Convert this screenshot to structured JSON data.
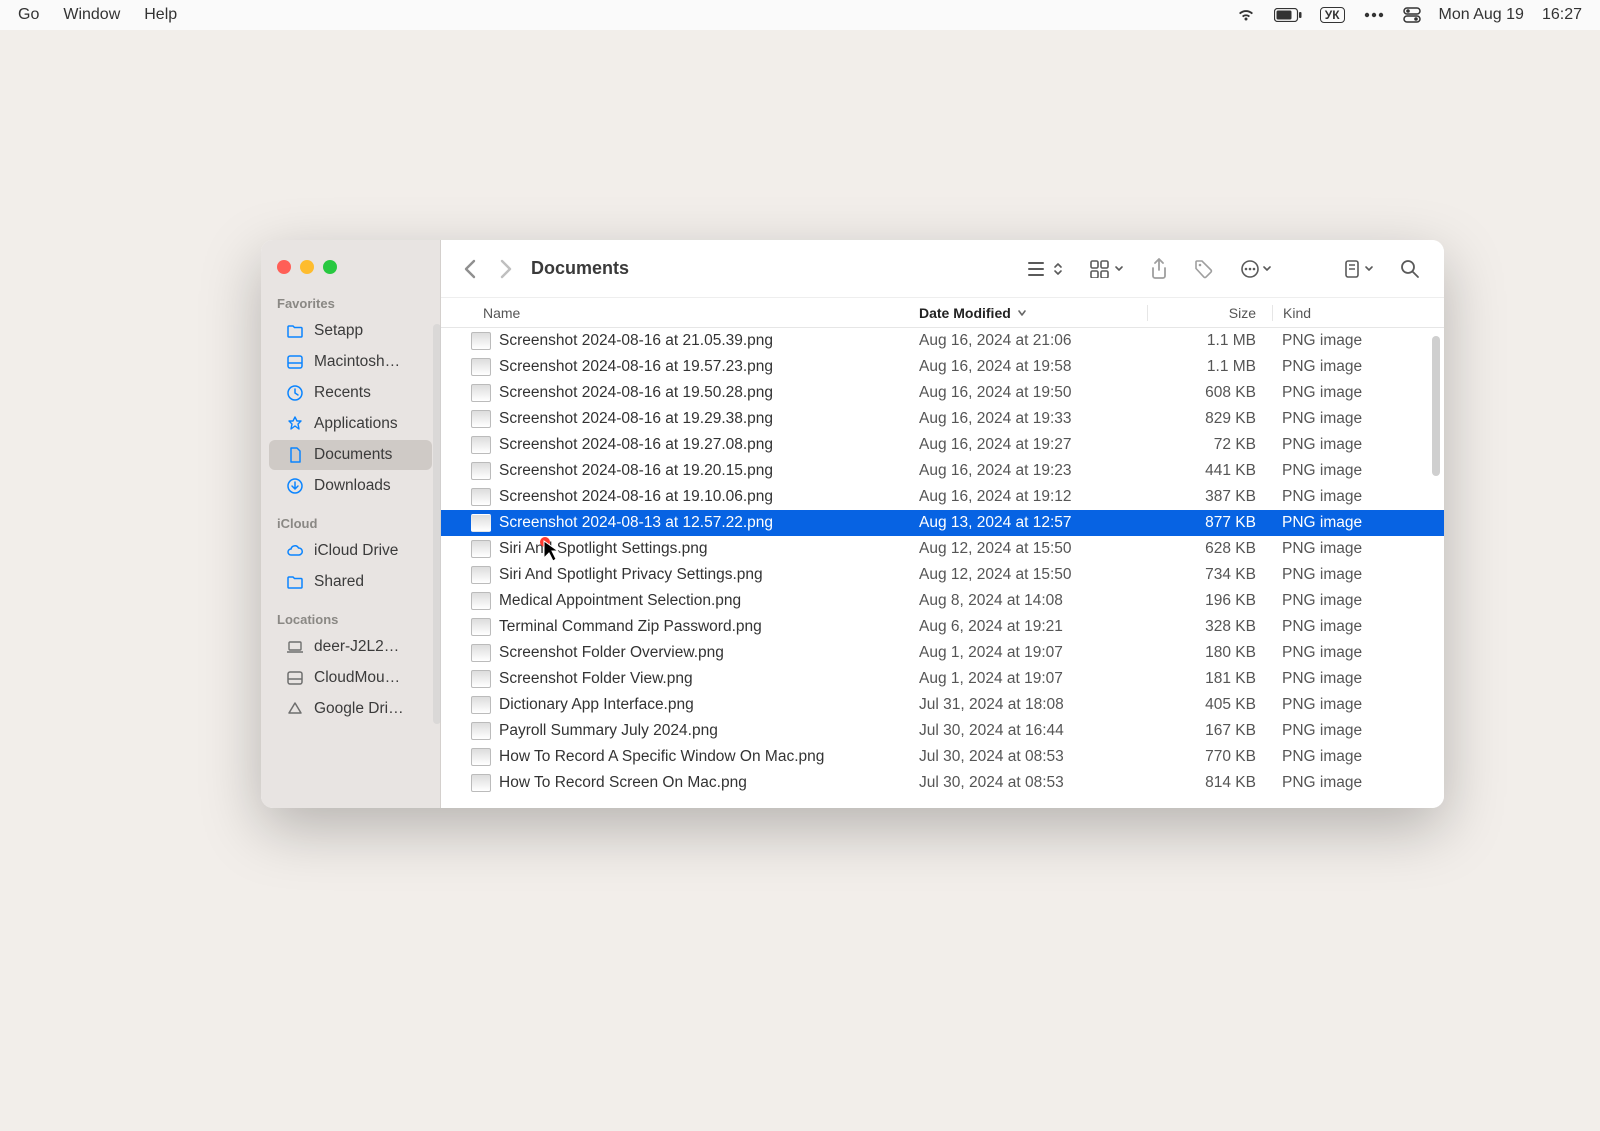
{
  "menubar": {
    "items": [
      "Go",
      "Window",
      "Help"
    ],
    "status": {
      "input_source": "УК",
      "date": "Mon Aug 19",
      "time": "16:27"
    }
  },
  "window": {
    "title": "Documents"
  },
  "sidebar": {
    "sections": [
      {
        "title": "Favorites",
        "items": [
          {
            "icon": "folder",
            "label": "Setapp"
          },
          {
            "icon": "disk",
            "label": "Macintosh…"
          },
          {
            "icon": "clock",
            "label": "Recents"
          },
          {
            "icon": "apps",
            "label": "Applications"
          },
          {
            "icon": "doc",
            "label": "Documents",
            "active": true
          },
          {
            "icon": "download",
            "label": "Downloads"
          }
        ]
      },
      {
        "title": "iCloud",
        "items": [
          {
            "icon": "cloud",
            "label": "iCloud Drive"
          },
          {
            "icon": "folder",
            "label": "Shared"
          }
        ]
      },
      {
        "title": "Locations",
        "items": [
          {
            "icon": "laptop",
            "label": "deer-J2L2…",
            "gray": true
          },
          {
            "icon": "disk",
            "label": "CloudMou…",
            "gray": true
          },
          {
            "icon": "mount",
            "label": "Google Dri…",
            "gray": true
          }
        ]
      }
    ]
  },
  "columns": {
    "name": "Name",
    "date": "Date Modified",
    "size": "Size",
    "kind": "Kind"
  },
  "files": [
    {
      "name": "Screenshot 2024-08-16 at 21.05.39.png",
      "date": "Aug 16, 2024 at 21:06",
      "size": "1.1 MB",
      "kind": "PNG image"
    },
    {
      "name": "Screenshot 2024-08-16 at 19.57.23.png",
      "date": "Aug 16, 2024 at 19:58",
      "size": "1.1 MB",
      "kind": "PNG image"
    },
    {
      "name": "Screenshot 2024-08-16 at 19.50.28.png",
      "date": "Aug 16, 2024 at 19:50",
      "size": "608 KB",
      "kind": "PNG image"
    },
    {
      "name": "Screenshot 2024-08-16 at 19.29.38.png",
      "date": "Aug 16, 2024 at 19:33",
      "size": "829 KB",
      "kind": "PNG image"
    },
    {
      "name": "Screenshot 2024-08-16 at 19.27.08.png",
      "date": "Aug 16, 2024 at 19:27",
      "size": "72 KB",
      "kind": "PNG image"
    },
    {
      "name": "Screenshot 2024-08-16 at 19.20.15.png",
      "date": "Aug 16, 2024 at 19:23",
      "size": "441 KB",
      "kind": "PNG image"
    },
    {
      "name": "Screenshot 2024-08-16 at 19.10.06.png",
      "date": "Aug 16, 2024 at 19:12",
      "size": "387 KB",
      "kind": "PNG image"
    },
    {
      "name": "Screenshot 2024-08-13 at 12.57.22.png",
      "date": "Aug 13, 2024 at 12:57",
      "size": "877 KB",
      "kind": "PNG image",
      "selected": true
    },
    {
      "name": "Siri And Spotlight Settings.png",
      "date": "Aug 12, 2024 at 15:50",
      "size": "628 KB",
      "kind": "PNG image"
    },
    {
      "name": "Siri And Spotlight Privacy Settings.png",
      "date": "Aug 12, 2024 at 15:50",
      "size": "734 KB",
      "kind": "PNG image"
    },
    {
      "name": "Medical Appointment Selection.png",
      "date": "Aug 8, 2024 at 14:08",
      "size": "196 KB",
      "kind": "PNG image"
    },
    {
      "name": "Terminal Command Zip Password.png",
      "date": "Aug 6, 2024 at 19:21",
      "size": "328 KB",
      "kind": "PNG image"
    },
    {
      "name": "Screenshot Folder Overview.png",
      "date": "Aug 1, 2024 at 19:07",
      "size": "180 KB",
      "kind": "PNG image"
    },
    {
      "name": "Screenshot Folder View.png",
      "date": "Aug 1, 2024 at 19:07",
      "size": "181 KB",
      "kind": "PNG image"
    },
    {
      "name": "Dictionary App Interface.png",
      "date": "Jul 31, 2024 at 18:08",
      "size": "405 KB",
      "kind": "PNG image"
    },
    {
      "name": "Payroll Summary July 2024.png",
      "date": "Jul 30, 2024 at 16:44",
      "size": "167 KB",
      "kind": "PNG image"
    },
    {
      "name": "How To Record A Specific Window On Mac.png",
      "date": "Jul 30, 2024 at 08:53",
      "size": "770 KB",
      "kind": "PNG image"
    },
    {
      "name": "How To Record Screen On Mac.png",
      "date": "Jul 30, 2024 at 08:53",
      "size": "814 KB",
      "kind": "PNG image"
    }
  ]
}
